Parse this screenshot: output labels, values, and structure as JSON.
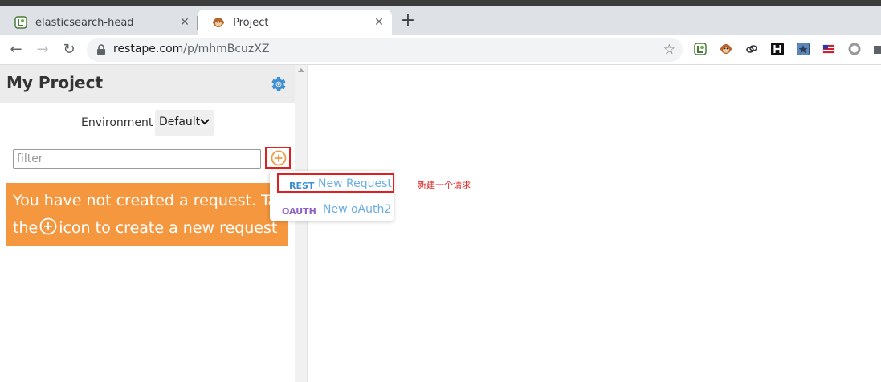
{
  "browser": {
    "tabs": [
      {
        "title": "elasticsearch-head",
        "icon": "elasticsearch-head-icon"
      },
      {
        "title": "Project",
        "icon": "monkey-icon"
      }
    ],
    "url_host": "restape.com",
    "url_path": "/p/mhmBcuzXZ"
  },
  "project": {
    "title": "My Project",
    "environment_label": "Environment",
    "environment_value": "Default",
    "filter_placeholder": "filter",
    "empty_line1": "You have not created a request. Ta",
    "empty_line2_pre": "the",
    "empty_line2_post": "icon to create a new request"
  },
  "menu": {
    "rest_method": "REST",
    "rest_label": "New Request",
    "oauth_method": "OAUTH",
    "oauth_label": "New oAuth2"
  },
  "annotation": "新建一个请求",
  "colors": {
    "orange": "#f5973f",
    "accent_blue": "#3d8fd1",
    "oauth_purple": "#8e5fc4",
    "highlight_red": "#e02020"
  }
}
